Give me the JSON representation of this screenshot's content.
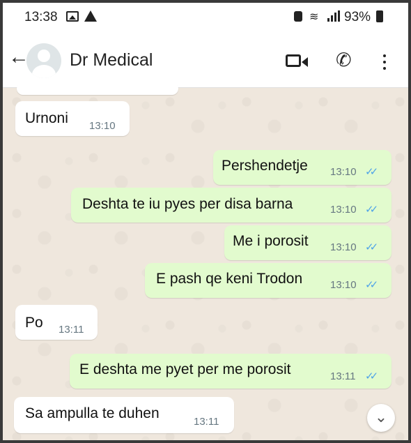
{
  "status_bar": {
    "time": "13:38",
    "battery": "93%"
  },
  "header": {
    "contact_name": "Dr Medical"
  },
  "messages": [
    {
      "direction": "incoming",
      "text": "Urnoni",
      "time": "13:10"
    },
    {
      "direction": "outgoing",
      "text": "Pershendetje",
      "time": "13:10",
      "ticks": "✓✓"
    },
    {
      "direction": "outgoing",
      "text": "Deshta te iu pyes per disa barna",
      "time": "13:10",
      "ticks": "✓✓"
    },
    {
      "direction": "outgoing",
      "text": "Me i porosit",
      "time": "13:10",
      "ticks": "✓✓"
    },
    {
      "direction": "outgoing",
      "text": "E pash qe keni Trodon",
      "time": "13:10",
      "ticks": "✓✓"
    },
    {
      "direction": "incoming",
      "text": "Po",
      "time": "13:11"
    },
    {
      "direction": "outgoing",
      "text": "E deshta me pyet per me porosit",
      "time": "13:11",
      "ticks": "✓✓"
    },
    {
      "direction": "incoming",
      "text": "Sa ampulla te duhen",
      "time": "13:11"
    }
  ],
  "icons": {
    "back": "arrow-left-icon",
    "video": "video-call-icon",
    "call": "phone-icon",
    "menu": "more-vertical-icon",
    "scroll": "chevron-double-down-icon"
  },
  "colors": {
    "outgoing_bubble": "#e2fbce",
    "incoming_bubble": "#ffffff",
    "read_ticks": "#4fa3e8"
  }
}
